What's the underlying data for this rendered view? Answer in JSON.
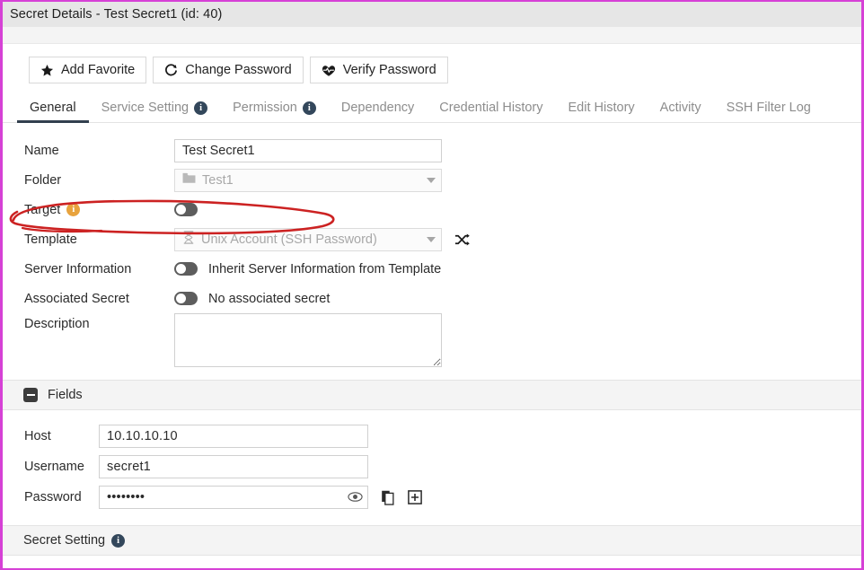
{
  "window": {
    "title": "Secret Details - Test Secret1 (id: 40)",
    "frame_color": "#d641d6"
  },
  "toolbar": {
    "buttons": [
      {
        "label": "Add Favorite",
        "icon": "star-icon"
      },
      {
        "label": "Change Password",
        "icon": "refresh-icon"
      },
      {
        "label": "Verify Password",
        "icon": "heartbeat-icon"
      }
    ]
  },
  "tabs": [
    {
      "label": "General",
      "active": true,
      "info": false
    },
    {
      "label": "Service Setting",
      "active": false,
      "info": true
    },
    {
      "label": "Permission",
      "active": false,
      "info": true
    },
    {
      "label": "Dependency",
      "active": false,
      "info": false
    },
    {
      "label": "Credential History",
      "active": false,
      "info": false
    },
    {
      "label": "Edit History",
      "active": false,
      "info": false
    },
    {
      "label": "Activity",
      "active": false,
      "info": false
    },
    {
      "label": "SSH Filter Log",
      "active": false,
      "info": false
    }
  ],
  "general": {
    "name": {
      "label": "Name",
      "value": "Test Secret1",
      "placeholder": ""
    },
    "folder": {
      "label": "Folder",
      "value": "Test1",
      "icon": "folder-icon"
    },
    "target": {
      "label": "Target",
      "info_color": "#e8a33d",
      "toggle_on": false
    },
    "template": {
      "label": "Template",
      "value": "Unix Account (SSH Password)",
      "icon": "hourglass-icon",
      "action_icon": "shuffle-icon"
    },
    "server_information": {
      "label": "Server Information",
      "toggle_on": false,
      "note": "Inherit Server Information from Template"
    },
    "associated_secret": {
      "label": "Associated Secret",
      "toggle_on": false,
      "note": "No associated secret"
    },
    "description": {
      "label": "Description",
      "value": "",
      "placeholder": ""
    }
  },
  "fields_section": {
    "title": "Fields",
    "collapsed": false,
    "rows": [
      {
        "label": "Host",
        "value": "10.10.10.10",
        "type": "text"
      },
      {
        "label": "Username",
        "value": "secret1",
        "type": "text"
      },
      {
        "label": "Password",
        "value": "••••••••",
        "type": "password"
      }
    ],
    "password_actions": [
      {
        "icon": "eye-icon"
      },
      {
        "icon": "copy-icon"
      },
      {
        "icon": "plus-box-icon"
      }
    ]
  },
  "secret_setting_section": {
    "title": "Secret Setting",
    "info": true
  },
  "annotation": {
    "type": "hand-drawn-ellipse",
    "color": "#cc2222",
    "target": "Target"
  }
}
